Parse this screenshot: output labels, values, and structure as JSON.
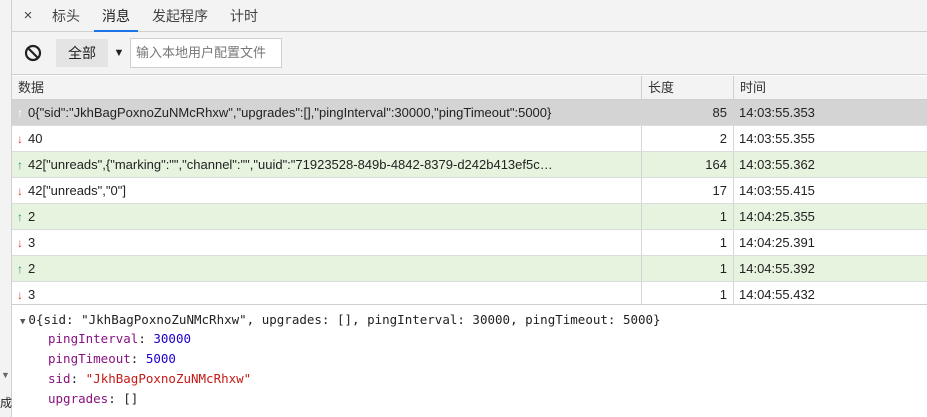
{
  "left_edge": {
    "text": "成"
  },
  "tabs": {
    "close_symbol": "×",
    "items": [
      {
        "label": "标头"
      },
      {
        "label": "消息"
      },
      {
        "label": "发起程序"
      },
      {
        "label": "计时"
      }
    ],
    "active_index": 1
  },
  "toolbar": {
    "filter_value": "全部",
    "caret": "▼",
    "search_placeholder": "输入本地用户配置文件"
  },
  "table": {
    "headers": {
      "data": "数据",
      "length": "长度",
      "time": "时间"
    },
    "rows": [
      {
        "dir": "neutral",
        "data": "0{\"sid\":\"JkhBagPoxnoZuNMcRhxw\",\"upgrades\":[],\"pingInterval\":30000,\"pingTimeout\":5000}",
        "length": "85",
        "time": "14:03:55.353"
      },
      {
        "dir": "down",
        "data": "40",
        "length": "2",
        "time": "14:03:55.355"
      },
      {
        "dir": "up",
        "data": "42[\"unreads\",{\"marking\":\"\",\"channel\":\"\",\"uuid\":\"71923528-849b-4842-8379-d242b413ef5c…",
        "length": "164",
        "time": "14:03:55.362"
      },
      {
        "dir": "down",
        "data": "42[\"unreads\",\"0\"]",
        "length": "17",
        "time": "14:03:55.415"
      },
      {
        "dir": "up",
        "data": "2",
        "length": "1",
        "time": "14:04:25.355"
      },
      {
        "dir": "down",
        "data": "3",
        "length": "1",
        "time": "14:04:25.391"
      },
      {
        "dir": "up",
        "data": "2",
        "length": "1",
        "time": "14:04:55.392"
      },
      {
        "dir": "down",
        "data": "3",
        "length": "1",
        "time": "14:04:55.432"
      }
    ]
  },
  "detail": {
    "summary": "0{sid: \"JkhBagPoxnoZuNMcRhxw\", upgrades: [], pingInterval: 30000, pingTimeout: 5000}",
    "properties": [
      {
        "key": "pingInterval",
        "value": "30000",
        "kind": "num"
      },
      {
        "key": "pingTimeout",
        "value": "5000",
        "kind": "num"
      },
      {
        "key": "sid",
        "value": "\"JkhBagPoxnoZuNMcRhxw\"",
        "kind": "str"
      },
      {
        "key": "upgrades",
        "value": "[]",
        "kind": "plain"
      }
    ]
  },
  "colors": {
    "active_tab_underline": "#1a73e8",
    "sent_row_bg": "#e6f4df",
    "selected_row_bg": "#d4d4d4",
    "up_arrow": "#2a8c7a",
    "down_arrow": "#d83b2b"
  },
  "icons": {
    "close": "close-icon",
    "block": "block-icon",
    "up": "arrow-up-icon",
    "down": "arrow-down-icon"
  }
}
